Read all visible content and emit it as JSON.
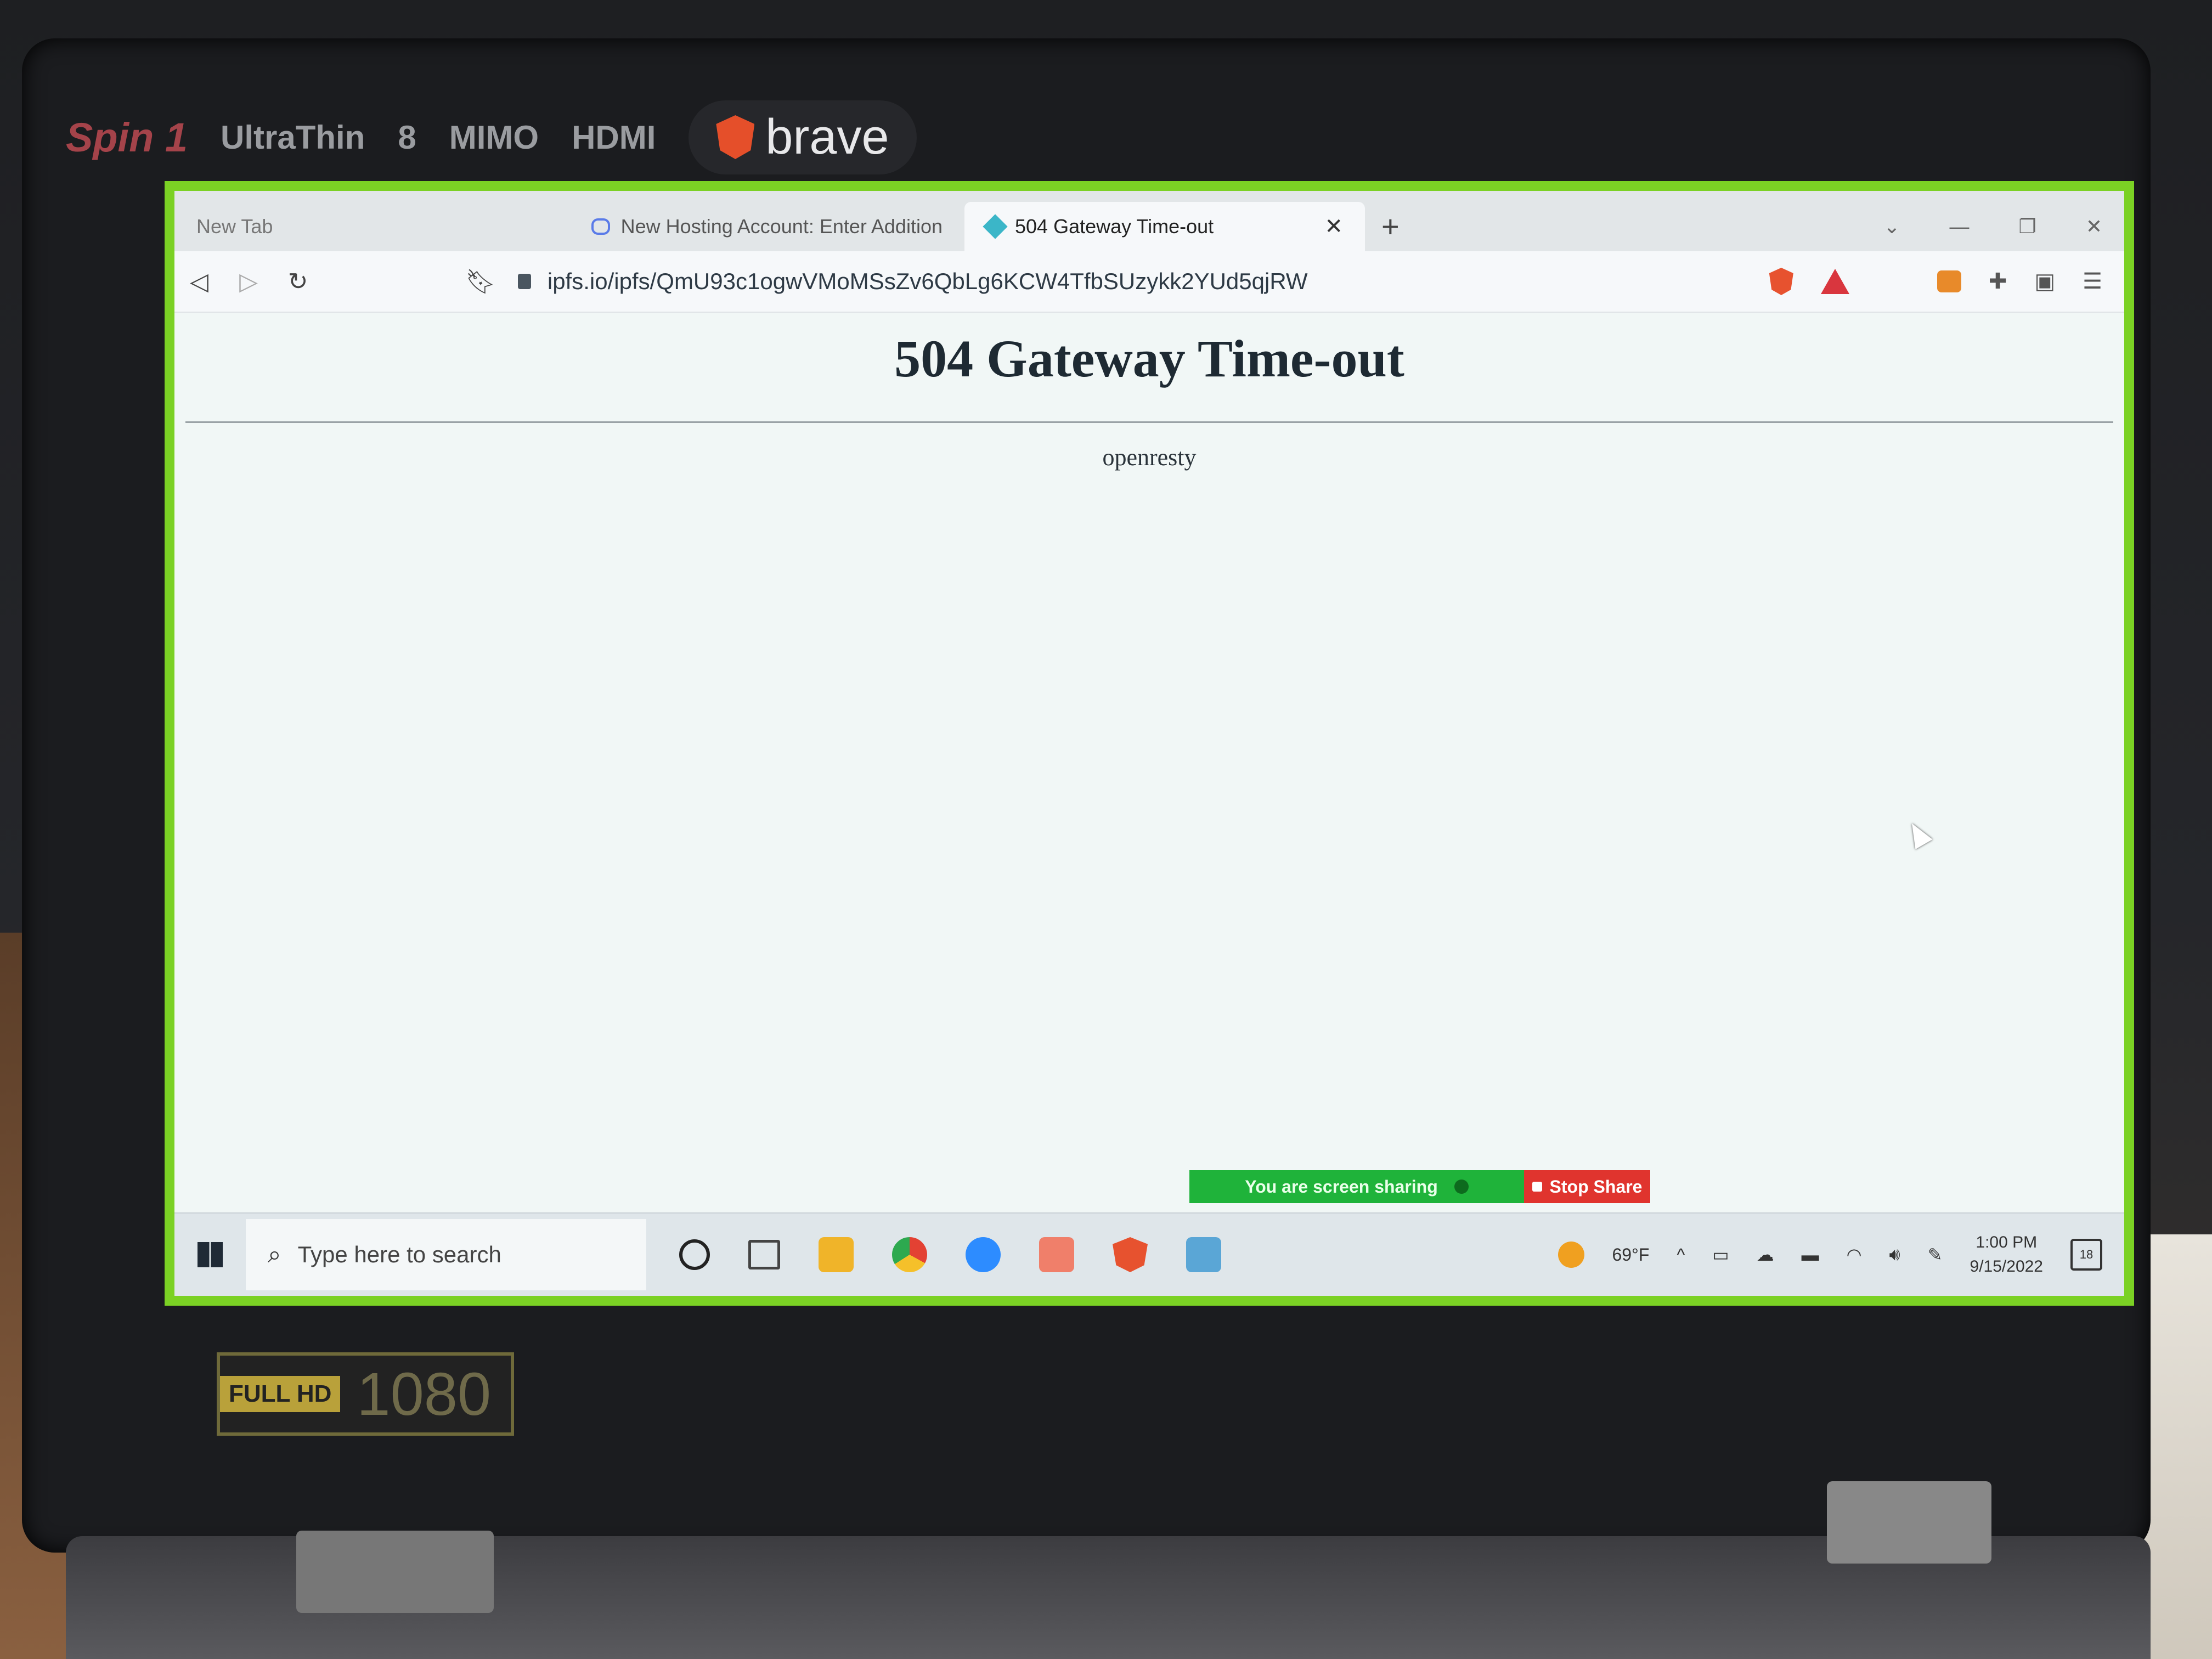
{
  "stickers": {
    "model": "Spin 1",
    "ultrathin": "UltraThin",
    "battery": "8",
    "mimo": "MIMO",
    "hdmi": "HDMI",
    "brand": "brave",
    "fullhd_tag": "FULL HD",
    "fullhd_num": "1080"
  },
  "browser": {
    "tabs": [
      {
        "label": "New Tab"
      },
      {
        "label": "New Hosting Account: Enter Addition"
      },
      {
        "label": "504 Gateway Time-out"
      }
    ],
    "new_tab_symbol": "+",
    "url": "ipfs.io/ipfs/QmU93c1ogwVMoMSsZv6QbLg6KCW4TfbSUzykk2YUd5qjRW"
  },
  "page": {
    "title": "504 Gateway Time-out",
    "server": "openresty"
  },
  "screen_share": {
    "status": "You are screen sharing",
    "stop_label": "Stop Share"
  },
  "taskbar": {
    "search_placeholder": "Type here to search",
    "weather": "69°F",
    "time": "1:00 PM",
    "date": "9/15/2022",
    "notification_count": "18"
  },
  "colors": {
    "screen_border": "#7bd124",
    "share_green": "#1fb33a",
    "stop_red": "#e0342e"
  }
}
